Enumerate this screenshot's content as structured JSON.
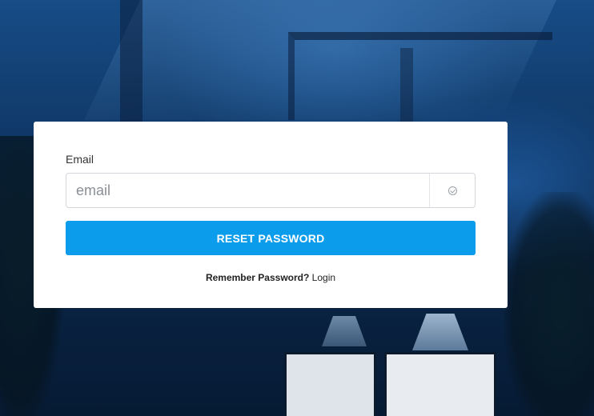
{
  "form": {
    "email_label": "Email",
    "email_placeholder": "email",
    "email_value": "",
    "email_addon_icon": "check-circle-icon",
    "submit_label": "RESET PASSWORD",
    "remember_text": "Remember Password?",
    "login_link": "Login"
  },
  "colors": {
    "accent": "#0b9cec",
    "card_background": "#ffffff",
    "page_background": "#0f3766"
  }
}
